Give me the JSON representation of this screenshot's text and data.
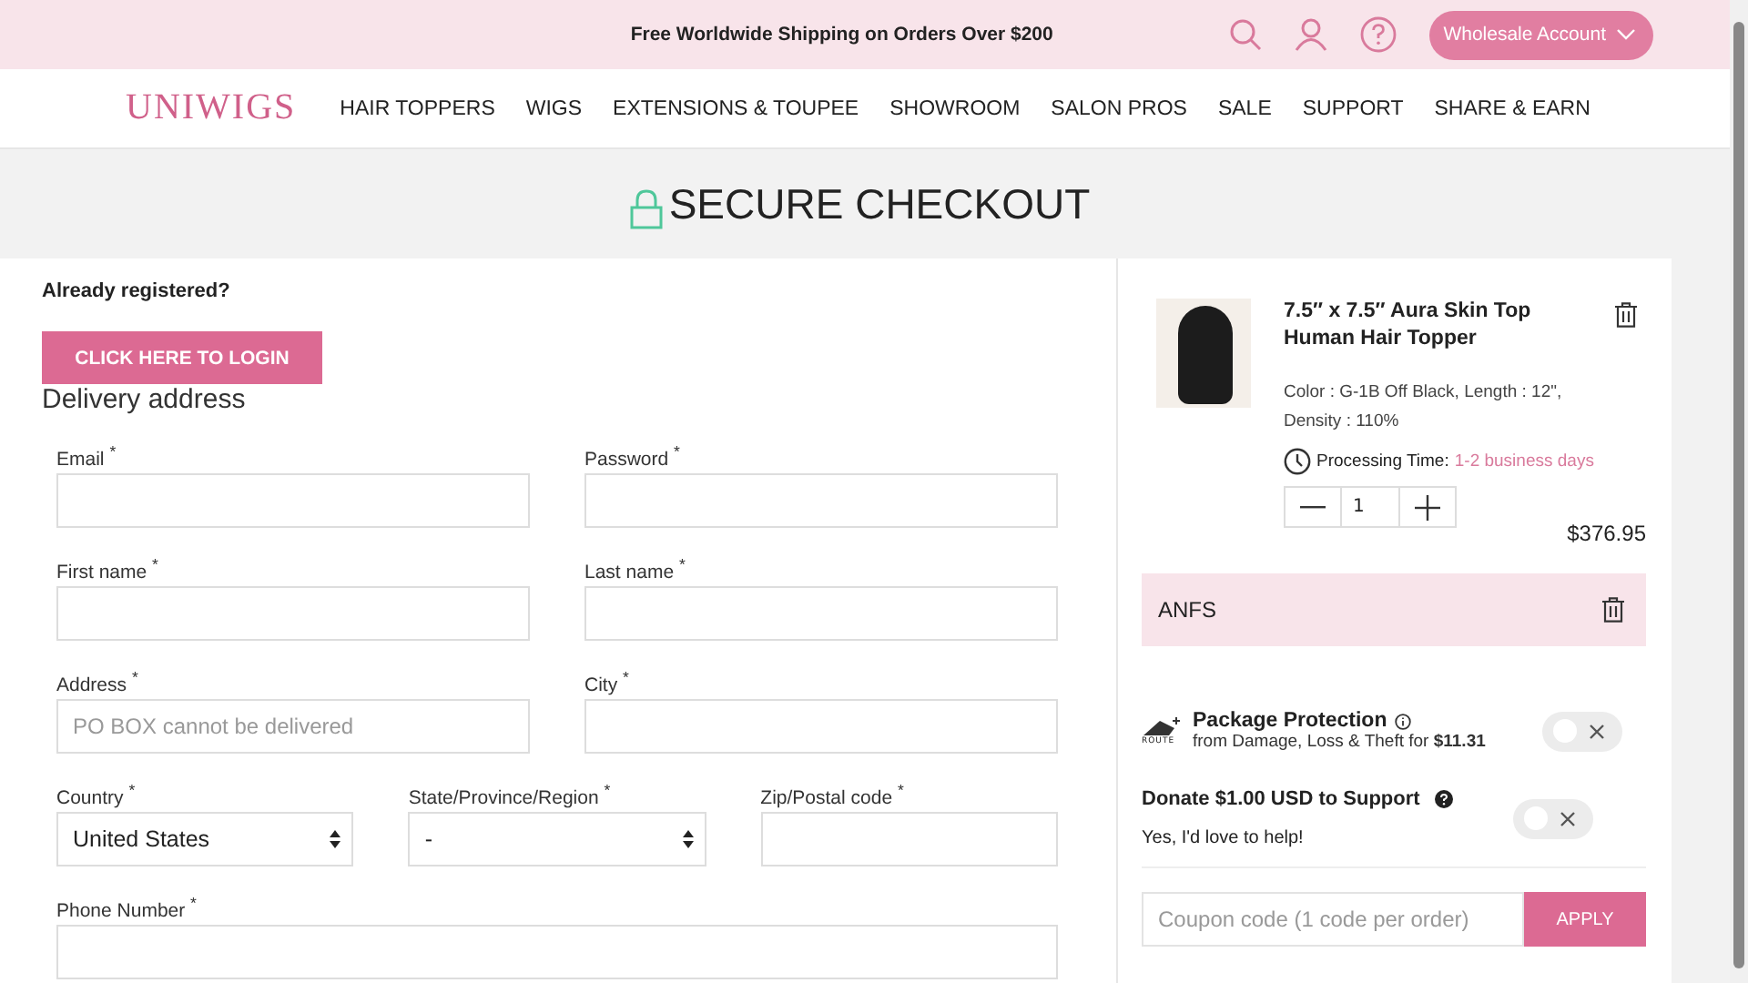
{
  "top_bar": {
    "announcement": "Free Worldwide Shipping on Orders Over $200",
    "account_button": "Wholesale Account"
  },
  "header": {
    "logo": "UNIWIGS",
    "nav": [
      "HAIR TOPPERS",
      "WIGS",
      "EXTENSIONS & TOUPEE",
      "SHOWROOM",
      "SALON PROS",
      "SALE",
      "SUPPORT",
      "SHARE & EARN"
    ]
  },
  "page_title": "SECURE CHECKOUT",
  "login": {
    "prompt": "Already registered?",
    "button": "CLICK HERE TO LOGIN"
  },
  "delivery": {
    "heading": "Delivery address",
    "rows": [
      [
        {
          "kind": "text",
          "label": "Email $^{*}$"
        },
        {
          "kind": "text",
          "label": "Password $^{*}$"
        }
      ],
      [
        {
          "kind": "text",
          "label": "First name $^{*}$"
        },
        {
          "kind": "text",
          "label": "Last name $^{*}$"
        }
      ],
      [
        {
          "kind": "text",
          "label": "Address $^{*}$",
          "placeholder": "PO BOX cannot be delivered"
        },
        {
          "kind": "text",
          "label": "City $^{*}$"
        }
      ],
      [
        {
          "kind": "select",
          "label": "Country $^{*}$",
          "value": "United States"
        },
        {
          "kind": "select",
          "label": "State/Province/Region $^{*}$",
          "value": "-"
        },
        {
          "kind": "text",
          "label": "Zip/Postal code $^{*}$"
        }
      ],
      [
        {
          "kind": "text",
          "label": "Phone Number $^{*}$"
        }
      ]
    ]
  },
  "cart": {
    "item": {
      "title": "7.5″ x 7.5″ Aura Skin Top Human Hair Topper",
      "options": "Color : G-1B Off Black, Length : 12\", Density : 110%",
      "processing_label": "Processing Time:",
      "processing_value": "1-2 business days",
      "quantity": "1",
      "price": "$376.95"
    },
    "discount": "ANFS",
    "protection": {
      "title": "Package Protection",
      "detail": "from Damage, Loss & Theft for **$11.31**",
      "logo_text": "ROUTE",
      "on": false
    },
    "donation": {
      "title": "Donate $1.00 USD to Support",
      "detail": "Yes, I'd love to help!",
      "on": false
    },
    "coupon": {
      "placeholder": "Coupon code (1 code per order)",
      "button": "APPLY"
    }
  }
}
